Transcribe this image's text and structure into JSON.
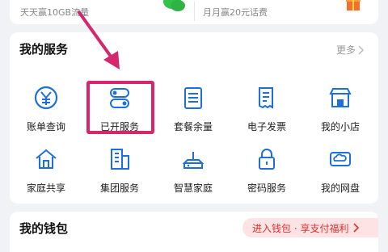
{
  "top": {
    "left_text": "天天赢10GB流量",
    "right_text": "月月赢20元话费"
  },
  "services": {
    "title": "我的服务",
    "more": "更多",
    "items": [
      {
        "label": "账单查询",
        "icon": "bill-icon"
      },
      {
        "label": "已开服务",
        "icon": "toggle-icon"
      },
      {
        "label": "套餐余量",
        "icon": "package-icon"
      },
      {
        "label": "电子发票",
        "icon": "invoice-icon"
      },
      {
        "label": "我的小店",
        "icon": "shop-icon"
      },
      {
        "label": "家庭共享",
        "icon": "home-icon"
      },
      {
        "label": "集团服务",
        "icon": "building-icon"
      },
      {
        "label": "智慧家庭",
        "icon": "router-icon"
      },
      {
        "label": "密码服务",
        "icon": "lock-icon"
      },
      {
        "label": "我的网盘",
        "icon": "cloud-drive-icon"
      }
    ]
  },
  "wallet": {
    "title": "我的钱包",
    "promo": "进入钱包 · 享支付福利"
  },
  "colors": {
    "accent": "#1e6fd9",
    "highlight": "#d8266e",
    "promo": "#e03131"
  }
}
